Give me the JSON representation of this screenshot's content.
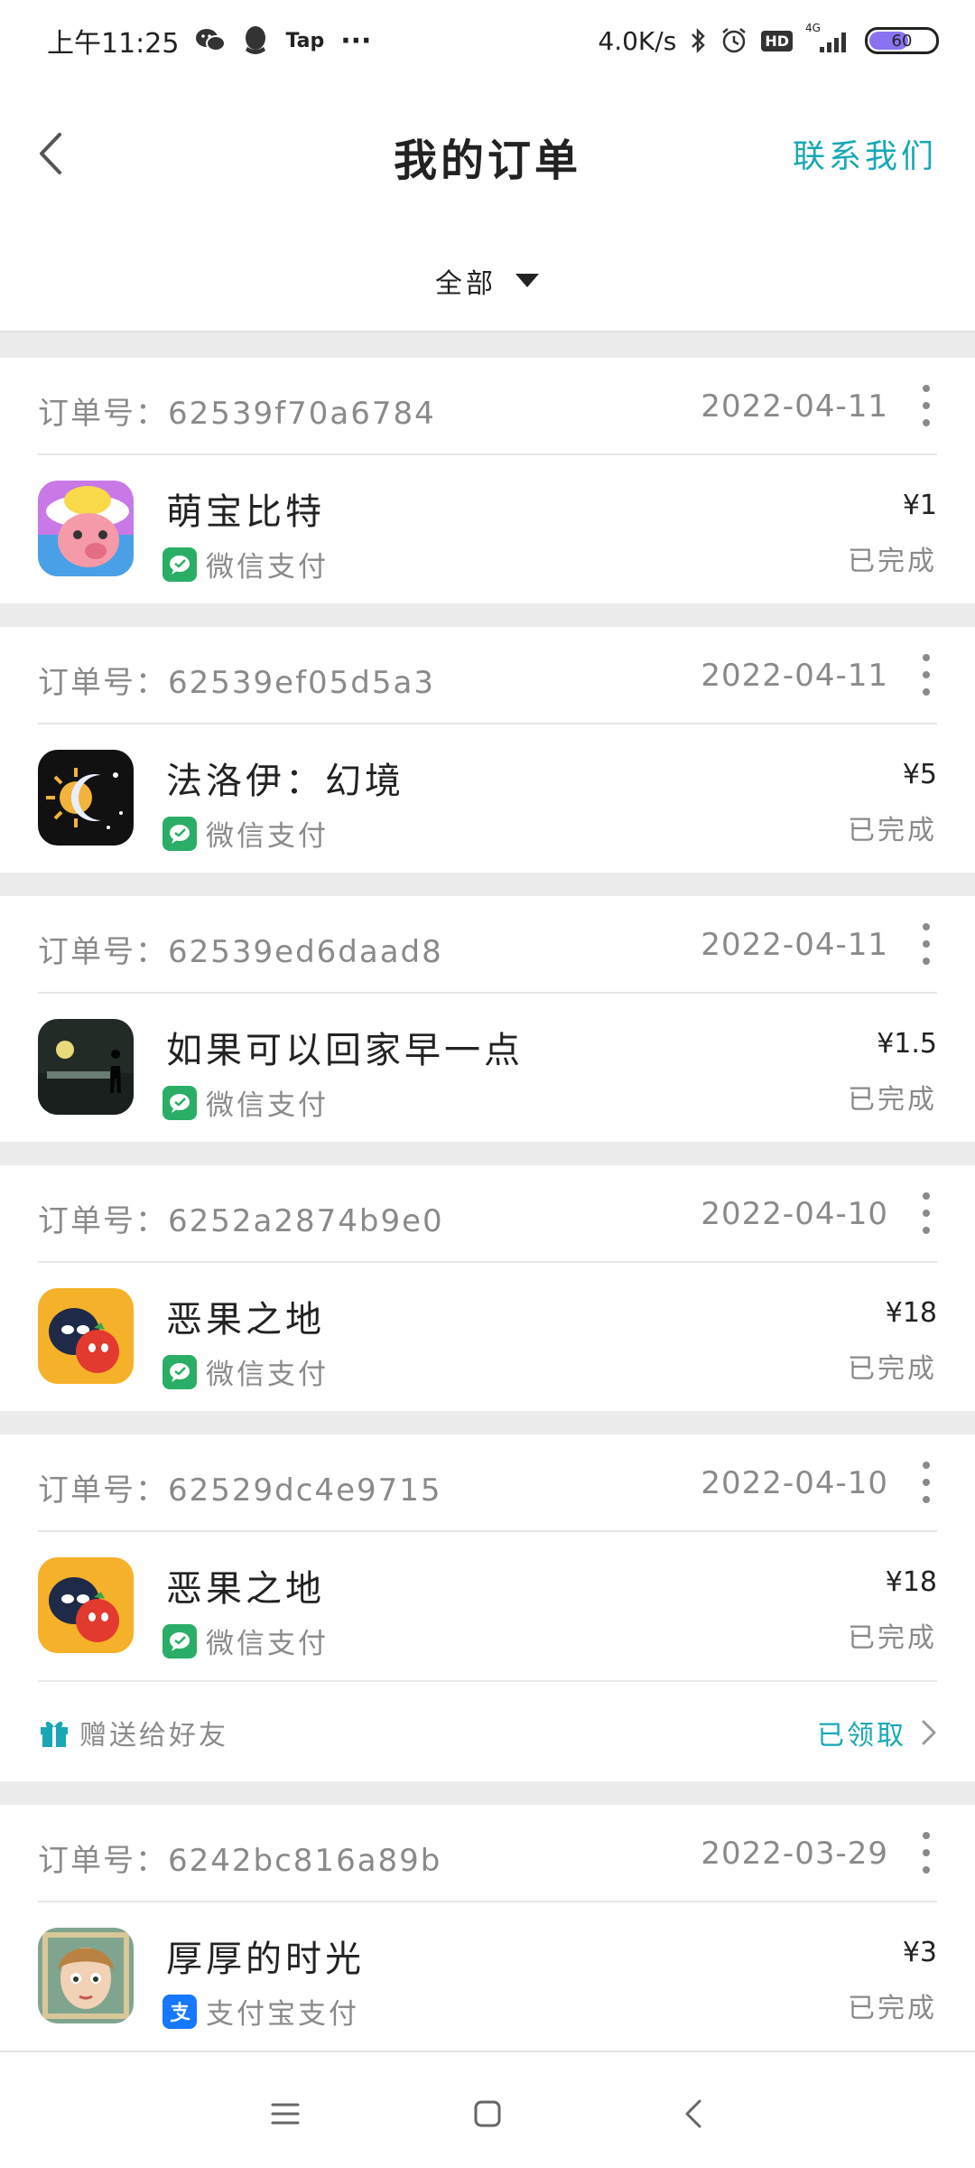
{
  "status_bar": {
    "time": "上午11:25",
    "tap_label": "Tap",
    "more": "···",
    "net_speed": "4.0K/s",
    "hd": "HD",
    "signal": "4G",
    "battery": "60",
    "battery_level": 0.6
  },
  "header": {
    "title": "我的订单",
    "contact": "联系我们"
  },
  "filter": {
    "selected": "全部"
  },
  "colors": {
    "accent": "#19a7b5",
    "wechat": "#2aae67",
    "alipay": "#1677ff",
    "battery": "#8a72f0"
  },
  "orders": [
    {
      "order_no": "订单号：62539f70a6784",
      "date": "2022-04-11",
      "game": "萌宝比特",
      "pay_method": "微信支付",
      "pay_icon": "wechat-pay-icon",
      "price": "¥1",
      "status": "已完成"
    },
    {
      "order_no": "订单号：62539ef05d5a3",
      "date": "2022-04-11",
      "game": "法洛伊：幻境",
      "pay_method": "微信支付",
      "pay_icon": "wechat-pay-icon",
      "price": "¥5",
      "status": "已完成"
    },
    {
      "order_no": "订单号：62539ed6daad8",
      "date": "2022-04-11",
      "game": "如果可以回家早一点",
      "pay_method": "微信支付",
      "pay_icon": "wechat-pay-icon",
      "price": "¥1.5",
      "status": "已完成"
    },
    {
      "order_no": "订单号：6252a2874b9e0",
      "date": "2022-04-10",
      "game": "恶果之地",
      "pay_method": "微信支付",
      "pay_icon": "wechat-pay-icon",
      "price": "¥18",
      "status": "已完成"
    },
    {
      "order_no": "订单号：62529dc4e9715",
      "date": "2022-04-10",
      "game": "恶果之地",
      "pay_method": "微信支付",
      "pay_icon": "wechat-pay-icon",
      "price": "¥18",
      "status": "已完成",
      "gift": {
        "label": "赠送给好友",
        "status": "已领取"
      }
    },
    {
      "order_no": "订单号：6242bc816a89b",
      "date": "2022-03-29",
      "game": "厚厚的时光",
      "pay_method": "支付宝支付",
      "pay_icon": "alipay-icon",
      "price": "¥3",
      "status": "已完成"
    }
  ]
}
